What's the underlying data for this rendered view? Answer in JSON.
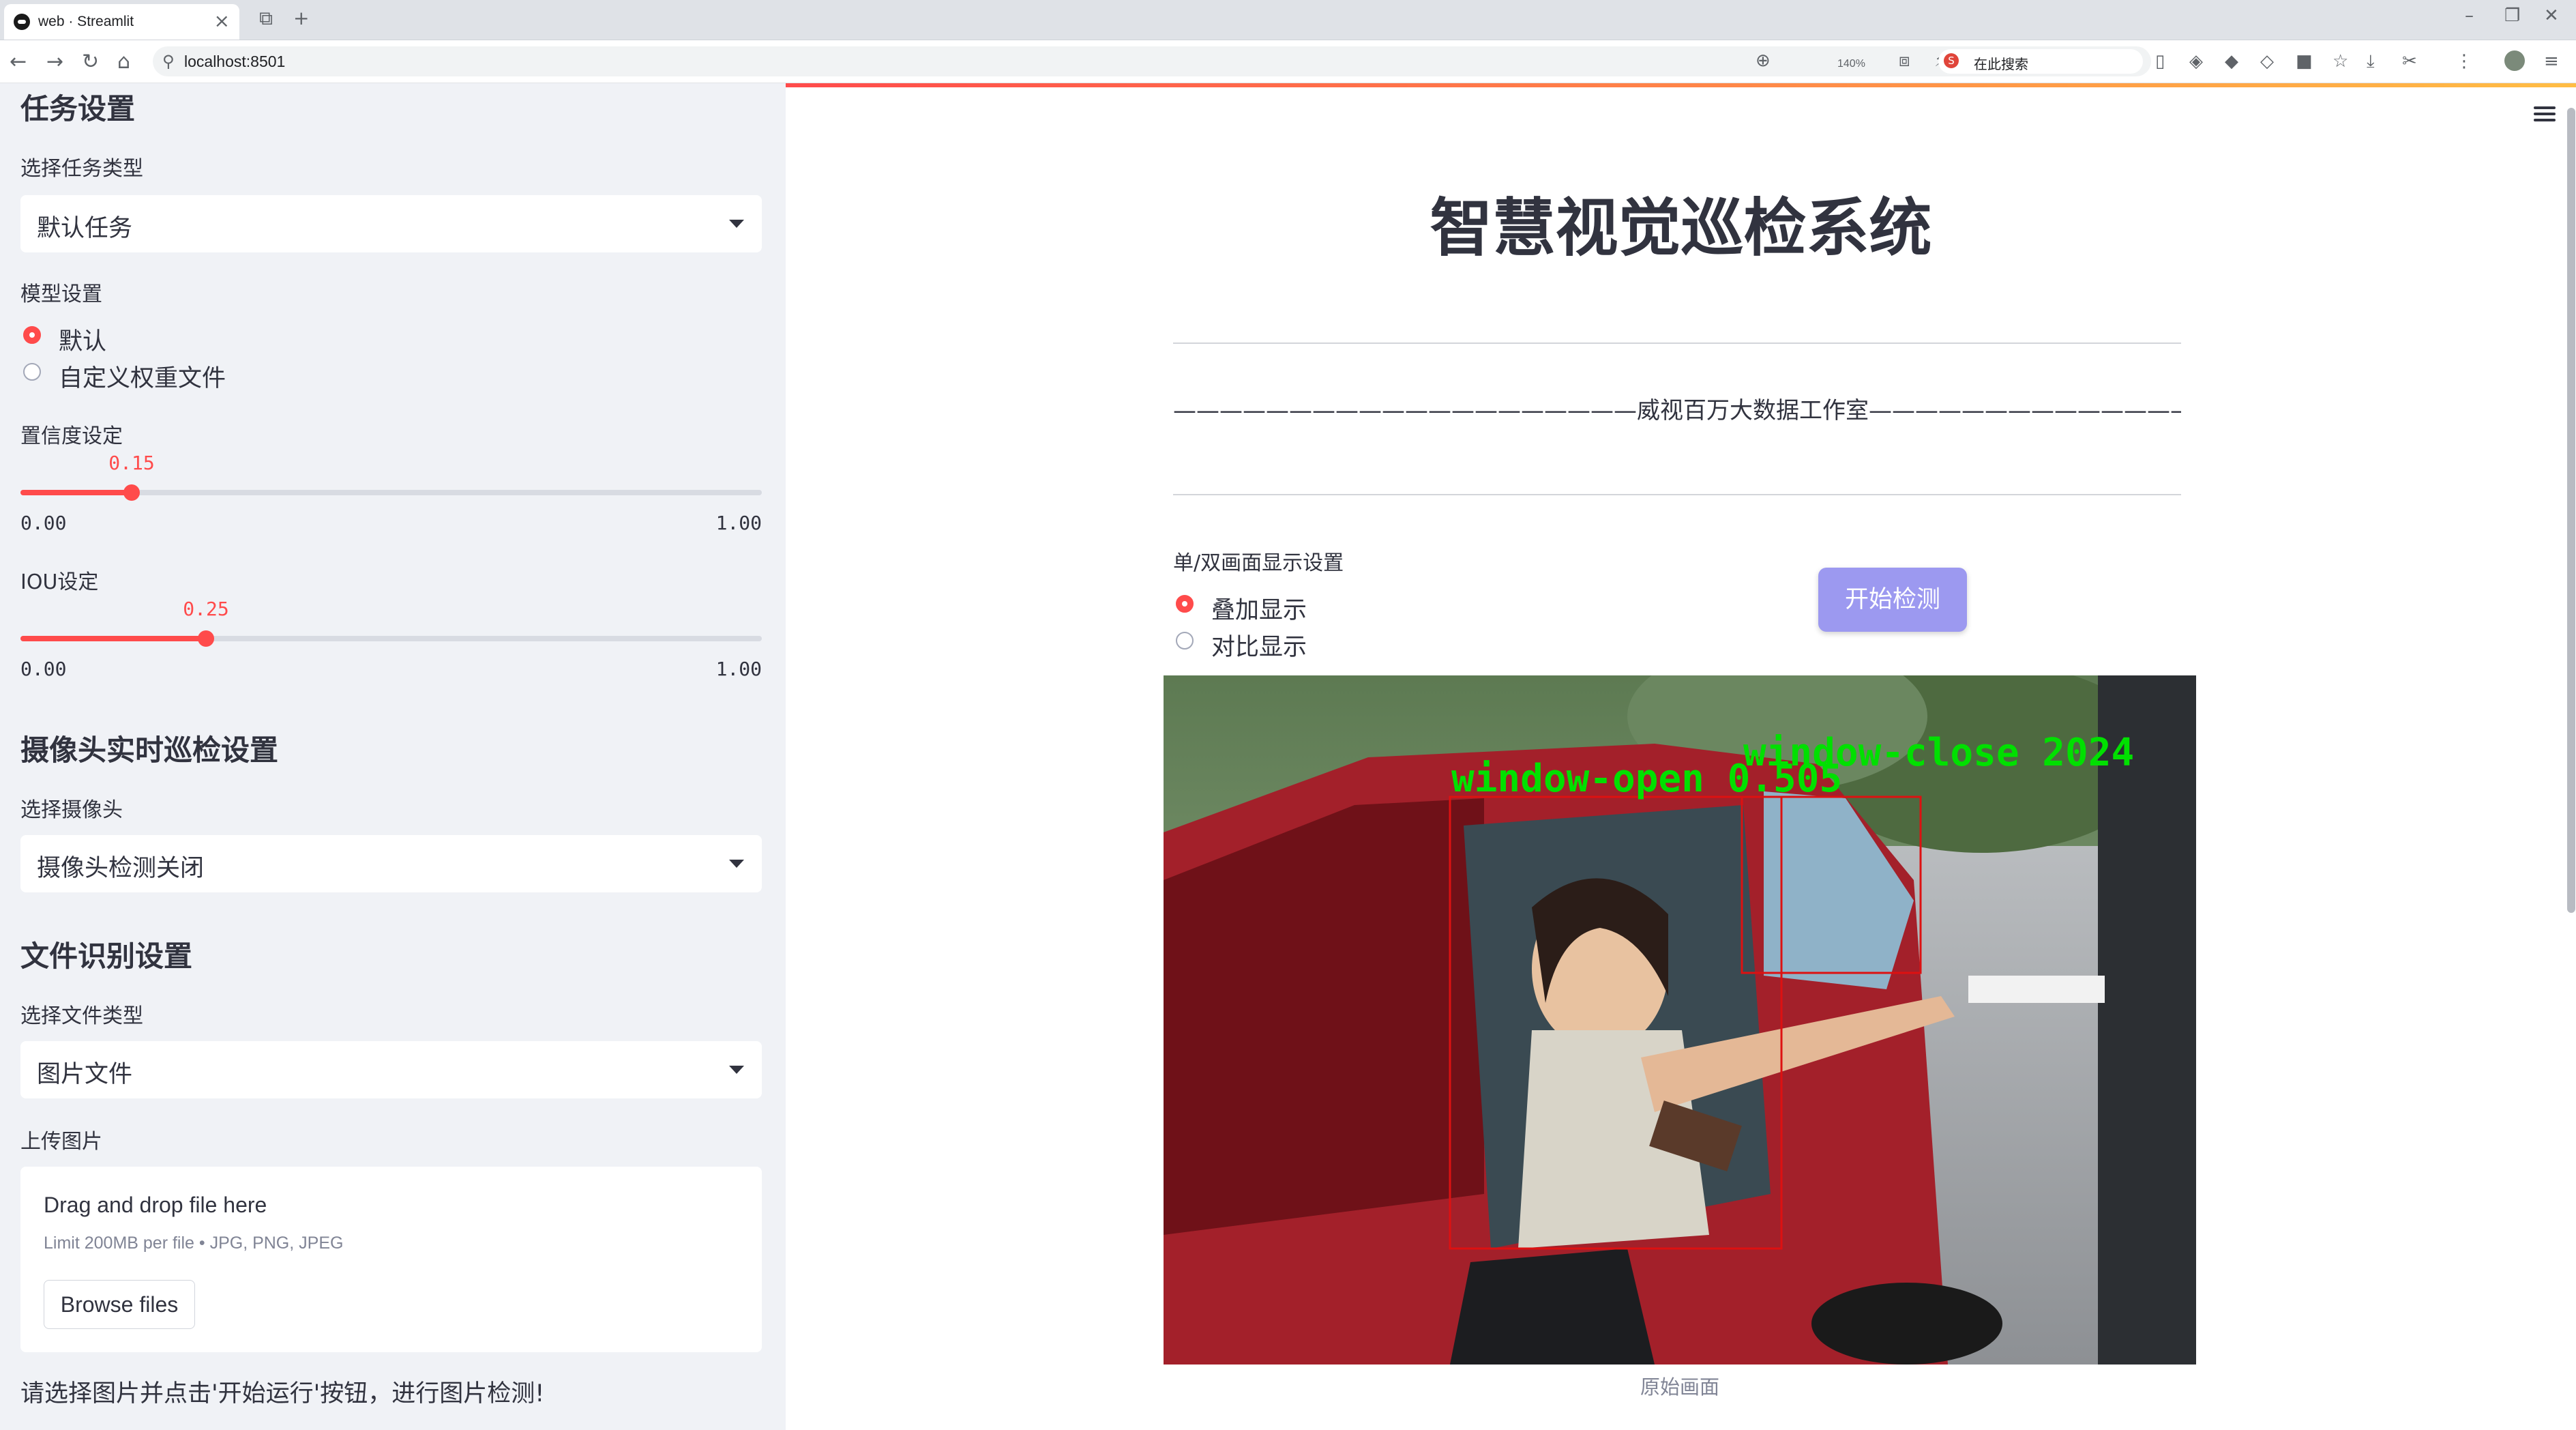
{
  "browser": {
    "tab_title": "web · Streamlit",
    "tab_close": "×",
    "new_tab": "+",
    "url": "localhost:8501",
    "zoom": "140%",
    "search_placeholder": "在此搜索",
    "search_engine_glyph": "S"
  },
  "sidebar": {
    "task_section_title": "任务设置",
    "task_type_label": "选择任务类型",
    "task_type_value": "默认任务",
    "model_label": "模型设置",
    "model_options": [
      "默认",
      "自定义权重文件"
    ],
    "model_selected": "默认",
    "confidence": {
      "label": "置信度设定",
      "value": "0.15",
      "min": "0.00",
      "max": "1.00",
      "fraction": 0.15
    },
    "iou": {
      "label": "IOU设定",
      "value": "0.25",
      "min": "0.00",
      "max": "1.00",
      "fraction": 0.25
    },
    "camera_section_title": "摄像头实时巡检设置",
    "camera_label": "选择摄像头",
    "camera_value": "摄像头检测关闭",
    "file_section_title": "文件识别设置",
    "file_type_label": "选择文件类型",
    "file_type_value": "图片文件",
    "upload_label": "上传图片",
    "upload_title": "Drag and drop file here",
    "upload_limit": "Limit 200MB per file • JPG, PNG, JPEG",
    "browse_label": "Browse files",
    "hint": "请选择图片并点击'开始运行'按钮，进行图片检测!"
  },
  "main": {
    "title": "智慧视觉巡检系统",
    "subtitle": "————————————————————威视百万大数据工作室—————————————————————",
    "display_label": "单/双画面显示设置",
    "display_options": [
      "叠加显示",
      "对比显示"
    ],
    "display_selected": "叠加显示",
    "start_button": "开始检测",
    "detections": [
      {
        "label": "window-open 0.505",
        "color": "#00e000"
      },
      {
        "label": "window-close 2024",
        "color": "#00e000"
      }
    ],
    "caption": "原始画面"
  },
  "colors": {
    "accent": "#ff4b4b",
    "button": "#9c99f0",
    "sidebar_bg": "#f0f2f6"
  }
}
